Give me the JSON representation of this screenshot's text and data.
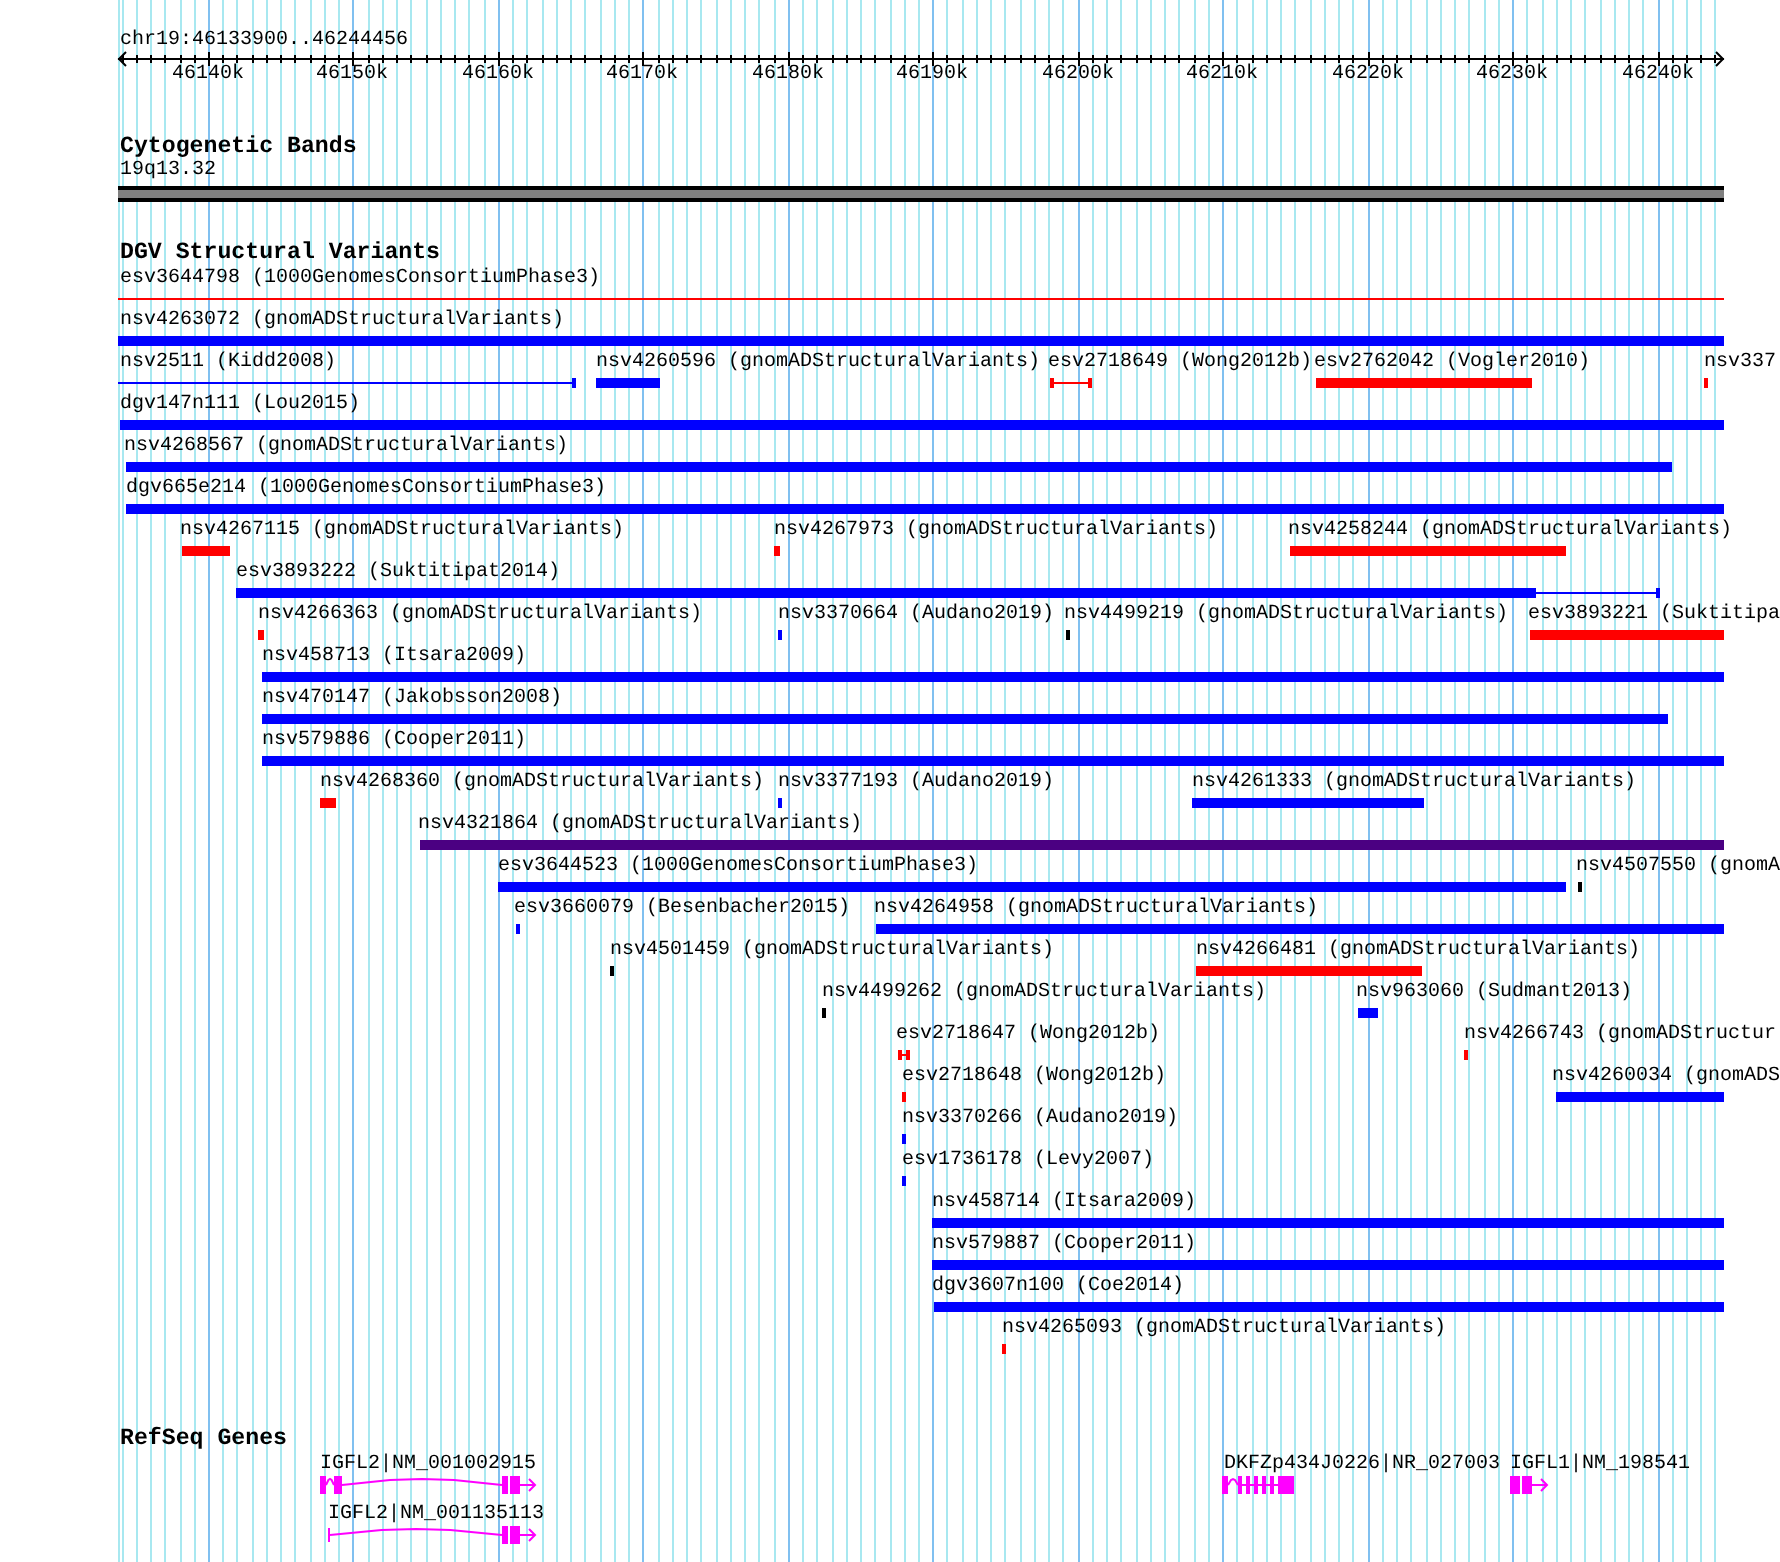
{
  "ruler": {
    "location": "chr19:46133900..46244456",
    "ticks": [
      "46140k",
      "46150k",
      "46160k",
      "46170k",
      "46180k",
      "46190k",
      "46200k",
      "46210k",
      "46220k",
      "46230k",
      "46240k"
    ]
  },
  "cytogenetic_bands": {
    "title": "Cytogenetic Bands",
    "band": "19q13.32"
  },
  "dgv_structural_variants": {
    "title": "DGV Structural Variants",
    "rows": [
      {
        "features": [
          {
            "label": "esv3644798 (1000GenomesConsortiumPhase3)",
            "color": "#ff0000"
          }
        ]
      },
      {
        "features": [
          {
            "label": "nsv4263072 (gnomADStructuralVariants)",
            "color": "#0000ff"
          }
        ]
      },
      {
        "features": [
          {
            "label": "nsv2511 (Kidd2008)",
            "color": "#0000ff"
          },
          {
            "label": "nsv4260596 (gnomADStructuralVariants)",
            "color": "#0000ff"
          },
          {
            "label": "esv2718649 (Wong2012b)",
            "color": "#ff0000"
          },
          {
            "label": "esv2762042 (Vogler2010)",
            "color": "#ff0000"
          },
          {
            "label": "nsv337",
            "color": "#ff0000"
          }
        ]
      },
      {
        "features": [
          {
            "label": "dgv147n111 (Lou2015)",
            "color": "#0000ff"
          }
        ]
      },
      {
        "features": [
          {
            "label": "nsv4268567 (gnomADStructuralVariants)",
            "color": "#0000ff"
          }
        ]
      },
      {
        "features": [
          {
            "label": "dgv665e214 (1000GenomesConsortiumPhase3)",
            "color": "#0000ff"
          }
        ]
      },
      {
        "features": [
          {
            "label": "nsv4267115 (gnomADStructuralVariants)",
            "color": "#ff0000"
          },
          {
            "label": "nsv4267973 (gnomADStructuralVariants)",
            "color": "#ff0000"
          },
          {
            "label": "nsv4258244 (gnomADStructuralVariants)",
            "color": "#ff0000"
          }
        ]
      },
      {
        "features": [
          {
            "label": "esv3893222 (Suktitipat2014)",
            "color": "#0000ff"
          }
        ]
      },
      {
        "features": [
          {
            "label": "nsv4266363 (gnomADStructuralVariants)",
            "color": "#ff0000"
          },
          {
            "label": "nsv3370664 (Audano2019)",
            "color": "#0000ff"
          },
          {
            "label": "nsv4499219 (gnomADStructuralVariants)",
            "color": "#000000"
          },
          {
            "label": "esv3893221 (Suktitipa",
            "color": "#ff0000"
          }
        ]
      },
      {
        "features": [
          {
            "label": "nsv458713 (Itsara2009)",
            "color": "#0000ff"
          }
        ]
      },
      {
        "features": [
          {
            "label": "nsv470147 (Jakobsson2008)",
            "color": "#0000ff"
          }
        ]
      },
      {
        "features": [
          {
            "label": "nsv579886 (Cooper2011)",
            "color": "#0000ff"
          }
        ]
      },
      {
        "features": [
          {
            "label": "nsv4268360 (gnomADStructuralVariants)",
            "color": "#ff0000"
          },
          {
            "label": "nsv3377193 (Audano2019)",
            "color": "#0000ff"
          },
          {
            "label": "nsv4261333 (gnomADStructuralVariants)",
            "color": "#0000ff"
          }
        ]
      },
      {
        "features": [
          {
            "label": "nsv4321864 (gnomADStructuralVariants)",
            "color": "#4b0082"
          }
        ]
      },
      {
        "features": [
          {
            "label": "esv3644523 (1000GenomesConsortiumPhase3)",
            "color": "#0000ff"
          },
          {
            "label": "nsv4507550 (gnomA",
            "color": "#000000"
          }
        ]
      },
      {
        "features": [
          {
            "label": "esv3660079 (Besenbacher2015)",
            "color": "#0000ff"
          },
          {
            "label": "nsv4264958 (gnomADStructuralVariants)",
            "color": "#0000ff"
          }
        ]
      },
      {
        "features": [
          {
            "label": "nsv4501459 (gnomADStructuralVariants)",
            "color": "#000000"
          },
          {
            "label": "nsv4266481 (gnomADStructuralVariants)",
            "color": "#ff0000"
          }
        ]
      },
      {
        "features": [
          {
            "label": "nsv4499262 (gnomADStructuralVariants)",
            "color": "#000000"
          },
          {
            "label": "nsv963060 (Sudmant2013)",
            "color": "#0000ff"
          }
        ]
      },
      {
        "features": [
          {
            "label": "esv2718647 (Wong2012b)",
            "color": "#ff0000"
          },
          {
            "label": "nsv4266743 (gnomADStructur",
            "color": "#ff0000"
          }
        ]
      },
      {
        "features": [
          {
            "label": "esv2718648 (Wong2012b)",
            "color": "#ff0000"
          },
          {
            "label": "nsv4260034 (gnomADS",
            "color": "#0000ff"
          }
        ]
      },
      {
        "features": [
          {
            "label": "nsv3370266 (Audano2019)",
            "color": "#0000ff"
          }
        ]
      },
      {
        "features": [
          {
            "label": "esv1736178 (Levy2007)",
            "color": "#0000ff"
          }
        ]
      },
      {
        "features": [
          {
            "label": "nsv458714 (Itsara2009)",
            "color": "#0000ff"
          }
        ]
      },
      {
        "features": [
          {
            "label": "nsv579887 (Cooper2011)",
            "color": "#0000ff"
          }
        ]
      },
      {
        "features": [
          {
            "label": "dgv3607n100 (Coe2014)",
            "color": "#0000ff"
          }
        ]
      },
      {
        "features": [
          {
            "label": "nsv4265093 (gnomADStructuralVariants)",
            "color": "#ff0000"
          }
        ]
      }
    ]
  },
  "refseq_genes": {
    "title": "RefSeq Genes",
    "rows": [
      {
        "genes": [
          {
            "label": "IGFL2|NM_001002915"
          },
          {
            "label": "DKFZp434J0226|NR_027003"
          },
          {
            "label": "IGFL1|NM_198541"
          }
        ]
      },
      {
        "genes": [
          {
            "label": "IGFL2|NM_001135113"
          }
        ]
      }
    ]
  }
}
